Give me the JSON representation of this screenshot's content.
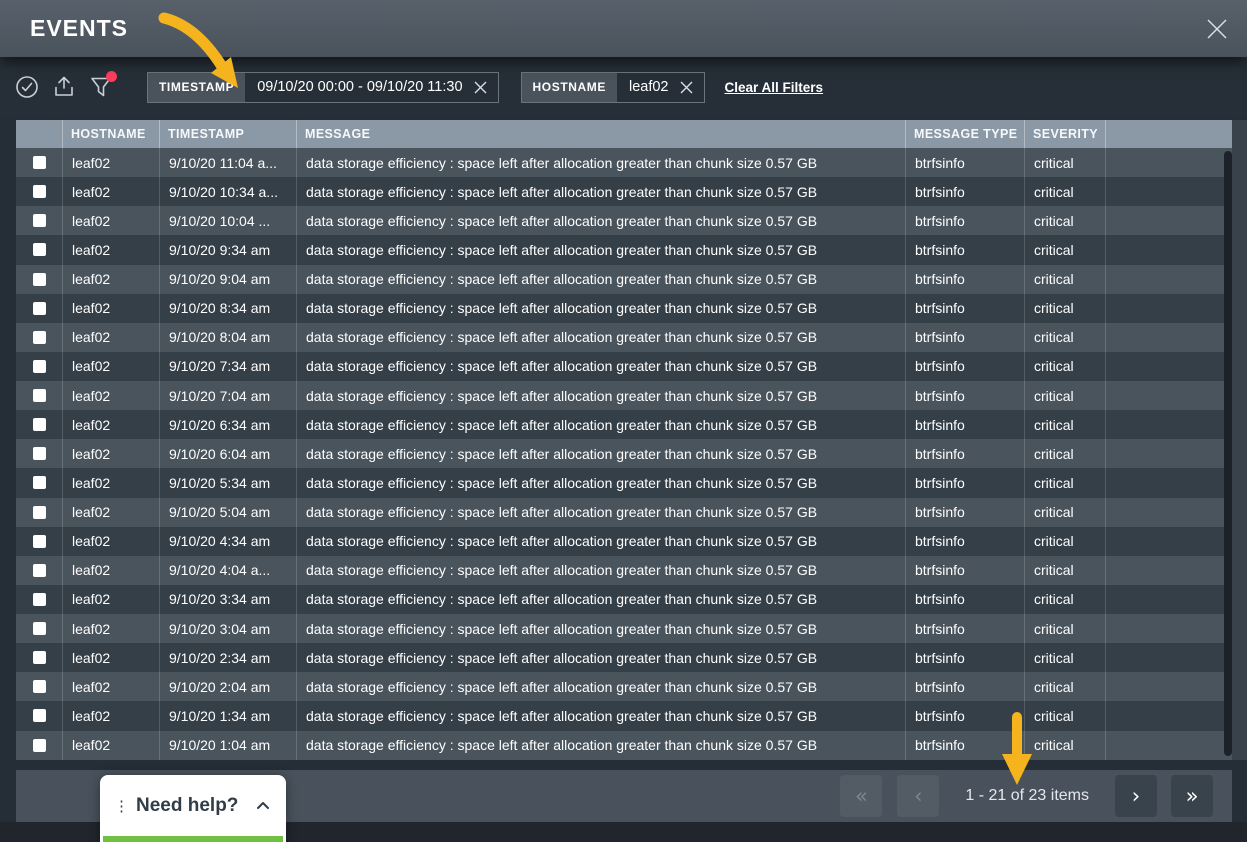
{
  "window": {
    "title": "EVENTS"
  },
  "toolbar": {
    "icons": [
      {
        "name": "select-all",
        "glyph": "check-circle"
      },
      {
        "name": "export",
        "glyph": "upload-arrow"
      },
      {
        "name": "filter",
        "glyph": "funnel",
        "has_badge": true
      }
    ],
    "filters": [
      {
        "field": "TIMESTAMP",
        "value": "09/10/20 00:00 - 09/10/20 11:30"
      },
      {
        "field": "HOSTNAME",
        "value": "leaf02"
      }
    ],
    "clear_all_label": "Clear All Filters"
  },
  "table": {
    "columns": [
      "HOSTNAME",
      "TIMESTAMP",
      "MESSAGE",
      "MESSAGE TYPE",
      "SEVERITY"
    ],
    "rows": [
      {
        "hostname": "leaf02",
        "timestamp": "9/10/20 11:04 a...",
        "message": "data storage efficiency : space left after allocation greater than chunk size 0.57 GB",
        "message_type": "btrfsinfo",
        "severity": "critical"
      },
      {
        "hostname": "leaf02",
        "timestamp": "9/10/20 10:34 a...",
        "message": "data storage efficiency : space left after allocation greater than chunk size 0.57 GB",
        "message_type": "btrfsinfo",
        "severity": "critical"
      },
      {
        "hostname": "leaf02",
        "timestamp": "9/10/20 10:04 ...",
        "message": "data storage efficiency : space left after allocation greater than chunk size 0.57 GB",
        "message_type": "btrfsinfo",
        "severity": "critical"
      },
      {
        "hostname": "leaf02",
        "timestamp": "9/10/20 9:34 am",
        "message": "data storage efficiency : space left after allocation greater than chunk size 0.57 GB",
        "message_type": "btrfsinfo",
        "severity": "critical"
      },
      {
        "hostname": "leaf02",
        "timestamp": "9/10/20 9:04 am",
        "message": "data storage efficiency : space left after allocation greater than chunk size 0.57 GB",
        "message_type": "btrfsinfo",
        "severity": "critical"
      },
      {
        "hostname": "leaf02",
        "timestamp": "9/10/20 8:34 am",
        "message": "data storage efficiency : space left after allocation greater than chunk size 0.57 GB",
        "message_type": "btrfsinfo",
        "severity": "critical"
      },
      {
        "hostname": "leaf02",
        "timestamp": "9/10/20 8:04 am",
        "message": "data storage efficiency : space left after allocation greater than chunk size 0.57 GB",
        "message_type": "btrfsinfo",
        "severity": "critical"
      },
      {
        "hostname": "leaf02",
        "timestamp": "9/10/20 7:34 am",
        "message": "data storage efficiency : space left after allocation greater than chunk size 0.57 GB",
        "message_type": "btrfsinfo",
        "severity": "critical"
      },
      {
        "hostname": "leaf02",
        "timestamp": "9/10/20 7:04 am",
        "message": "data storage efficiency : space left after allocation greater than chunk size 0.57 GB",
        "message_type": "btrfsinfo",
        "severity": "critical"
      },
      {
        "hostname": "leaf02",
        "timestamp": "9/10/20 6:34 am",
        "message": "data storage efficiency : space left after allocation greater than chunk size 0.57 GB",
        "message_type": "btrfsinfo",
        "severity": "critical"
      },
      {
        "hostname": "leaf02",
        "timestamp": "9/10/20 6:04 am",
        "message": "data storage efficiency : space left after allocation greater than chunk size 0.57 GB",
        "message_type": "btrfsinfo",
        "severity": "critical"
      },
      {
        "hostname": "leaf02",
        "timestamp": "9/10/20 5:34 am",
        "message": "data storage efficiency : space left after allocation greater than chunk size 0.57 GB",
        "message_type": "btrfsinfo",
        "severity": "critical"
      },
      {
        "hostname": "leaf02",
        "timestamp": "9/10/20 5:04 am",
        "message": "data storage efficiency : space left after allocation greater than chunk size 0.57 GB",
        "message_type": "btrfsinfo",
        "severity": "critical"
      },
      {
        "hostname": "leaf02",
        "timestamp": "9/10/20 4:34 am",
        "message": "data storage efficiency : space left after allocation greater than chunk size 0.57 GB",
        "message_type": "btrfsinfo",
        "severity": "critical"
      },
      {
        "hostname": "leaf02",
        "timestamp": "9/10/20 4:04 a...",
        "message": "data storage efficiency : space left after allocation greater than chunk size 0.57 GB",
        "message_type": "btrfsinfo",
        "severity": "critical"
      },
      {
        "hostname": "leaf02",
        "timestamp": "9/10/20 3:34 am",
        "message": "data storage efficiency : space left after allocation greater than chunk size 0.57 GB",
        "message_type": "btrfsinfo",
        "severity": "critical"
      },
      {
        "hostname": "leaf02",
        "timestamp": "9/10/20 3:04 am",
        "message": "data storage efficiency : space left after allocation greater than chunk size 0.57 GB",
        "message_type": "btrfsinfo",
        "severity": "critical"
      },
      {
        "hostname": "leaf02",
        "timestamp": "9/10/20 2:34 am",
        "message": "data storage efficiency : space left after allocation greater than chunk size 0.57 GB",
        "message_type": "btrfsinfo",
        "severity": "critical"
      },
      {
        "hostname": "leaf02",
        "timestamp": "9/10/20 2:04 am",
        "message": "data storage efficiency : space left after allocation greater than chunk size 0.57 GB",
        "message_type": "btrfsinfo",
        "severity": "critical"
      },
      {
        "hostname": "leaf02",
        "timestamp": "9/10/20 1:34 am",
        "message": "data storage efficiency : space left after allocation greater than chunk size 0.57 GB",
        "message_type": "btrfsinfo",
        "severity": "critical"
      },
      {
        "hostname": "leaf02",
        "timestamp": "9/10/20 1:04 am",
        "message": "data storage efficiency : space left after allocation greater than chunk size 0.57 GB",
        "message_type": "btrfsinfo",
        "severity": "critical"
      }
    ]
  },
  "pagination": {
    "first_label": "«",
    "prev_label": "‹",
    "next_label": "›",
    "last_label": "»",
    "status": "1 - 21 of 23 items"
  },
  "help": {
    "grip_icon": "⋮",
    "label": "Need help?"
  },
  "colors": {
    "annotation_arrow": "#f5b31d",
    "filter_badge": "#fb3e5c",
    "table_header_bg": "#8b99a7",
    "row_odd": "#4a545d",
    "row_even": "#343f48",
    "help_green": "#72c043"
  }
}
